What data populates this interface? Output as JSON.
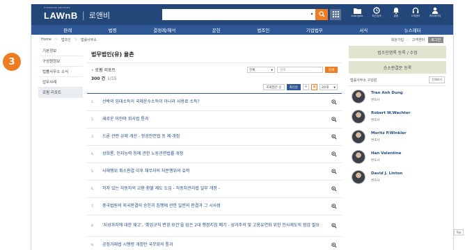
{
  "step_badge": "3",
  "header": {
    "logo_sub": "THOMSON REUTERS",
    "logo_main": "LAWnB",
    "logo_sep": "|",
    "logo_kr": "로앤비",
    "search_placeholder": "",
    "util": [
      {
        "icon": "folder-icon",
        "label": "Lawngate"
      },
      {
        "icon": "clock-icon",
        "label": "최근검색"
      },
      {
        "icon": "bell-icon",
        "label": "알림"
      },
      {
        "icon": "headset-icon",
        "label": "고객센터"
      },
      {
        "icon": "user-icon",
        "label": "마이페이지"
      }
    ]
  },
  "nav": [
    "판례",
    "법령",
    "결정례/해석",
    "문헌",
    "법조인",
    "기업법무",
    "서식",
    "뉴스레터"
  ],
  "breadcrumb": {
    "path": [
      "Home",
      "법조인",
      "법률사무소"
    ],
    "links": [
      "회원가입",
      "고객센터"
    ],
    "active": "로그인"
  },
  "leftnav": [
    "기본정보",
    "구성원정보",
    "법률사무소 소식",
    "업무사례",
    "로펌 리포트"
  ],
  "leftnav_active_index": 4,
  "main": {
    "title": "법무법인(유) 율촌",
    "section": "로펌 리포트",
    "filter_select": "전체",
    "filter_placeholder": "검색",
    "filter_button": "검색",
    "total": "300 건",
    "pages": "1/15",
    "sort_buttons": [
      "조회많은 순",
      "최신순"
    ],
    "sort_active_index": 1,
    "per_page": "20개",
    "rows": [
      {
        "num": "1.",
        "title": "선박의 임대소득이 국제운수소득이 아니라 사용료 소득?"
      },
      {
        "num": "2.",
        "title": "새로운 미얀마 회사법 통과"
      },
      {
        "num": "3.",
        "title": "드론 관련 규제 개선 - 항공안전법 등 제·개정"
      },
      {
        "num": "4.",
        "title": "성희롱, 인지능력 등에 관한 노동관련법률 개정"
      },
      {
        "num": "5.",
        "title": "사해행위 취소판결 이후 채무자의 처분행위의 효력"
      },
      {
        "num": "6.",
        "title": "허자 있는 자동차의 교환·환불 제도 도입 - 자동차관리법 일부 개정 -"
      },
      {
        "num": "7.",
        "title": "중국법원의 외국판결의 승인과 집행에 관한 일련의 판결과 그 시사점"
      },
      {
        "num": "8.",
        "title": "'지성과자에 대한 재고', '취업규칙 변경 요건'을 담은 2대 행정지침 폐기 - 성과주의 및 고용유연화 위한 인사제도의 점검 필요"
      },
      {
        "num": "9.",
        "title": "공정거래법 시행령 개정안 국무회의 통과"
      }
    ]
  },
  "right": {
    "buttons": [
      "법조인명록 등록 / 수정",
      "승소판결문 등록"
    ],
    "members_title": "법률사무소 구성원",
    "more": "전체보기",
    "members": [
      {
        "name": "Tran Anh Dung",
        "role": "변호사"
      },
      {
        "name": "Robert W.Wachter",
        "role": "변호사"
      },
      {
        "name": "Moritz P.Winkler",
        "role": "변호사"
      },
      {
        "name": "Han Valentine",
        "role": "변호사"
      },
      {
        "name": "David J. Linton",
        "role": "변호사"
      }
    ]
  },
  "top_button": "Top",
  "colors": {
    "brand_dark": "#24477a",
    "nav": "#2f5896",
    "accent": "#ee7d22",
    "link": "#1e4a86"
  }
}
